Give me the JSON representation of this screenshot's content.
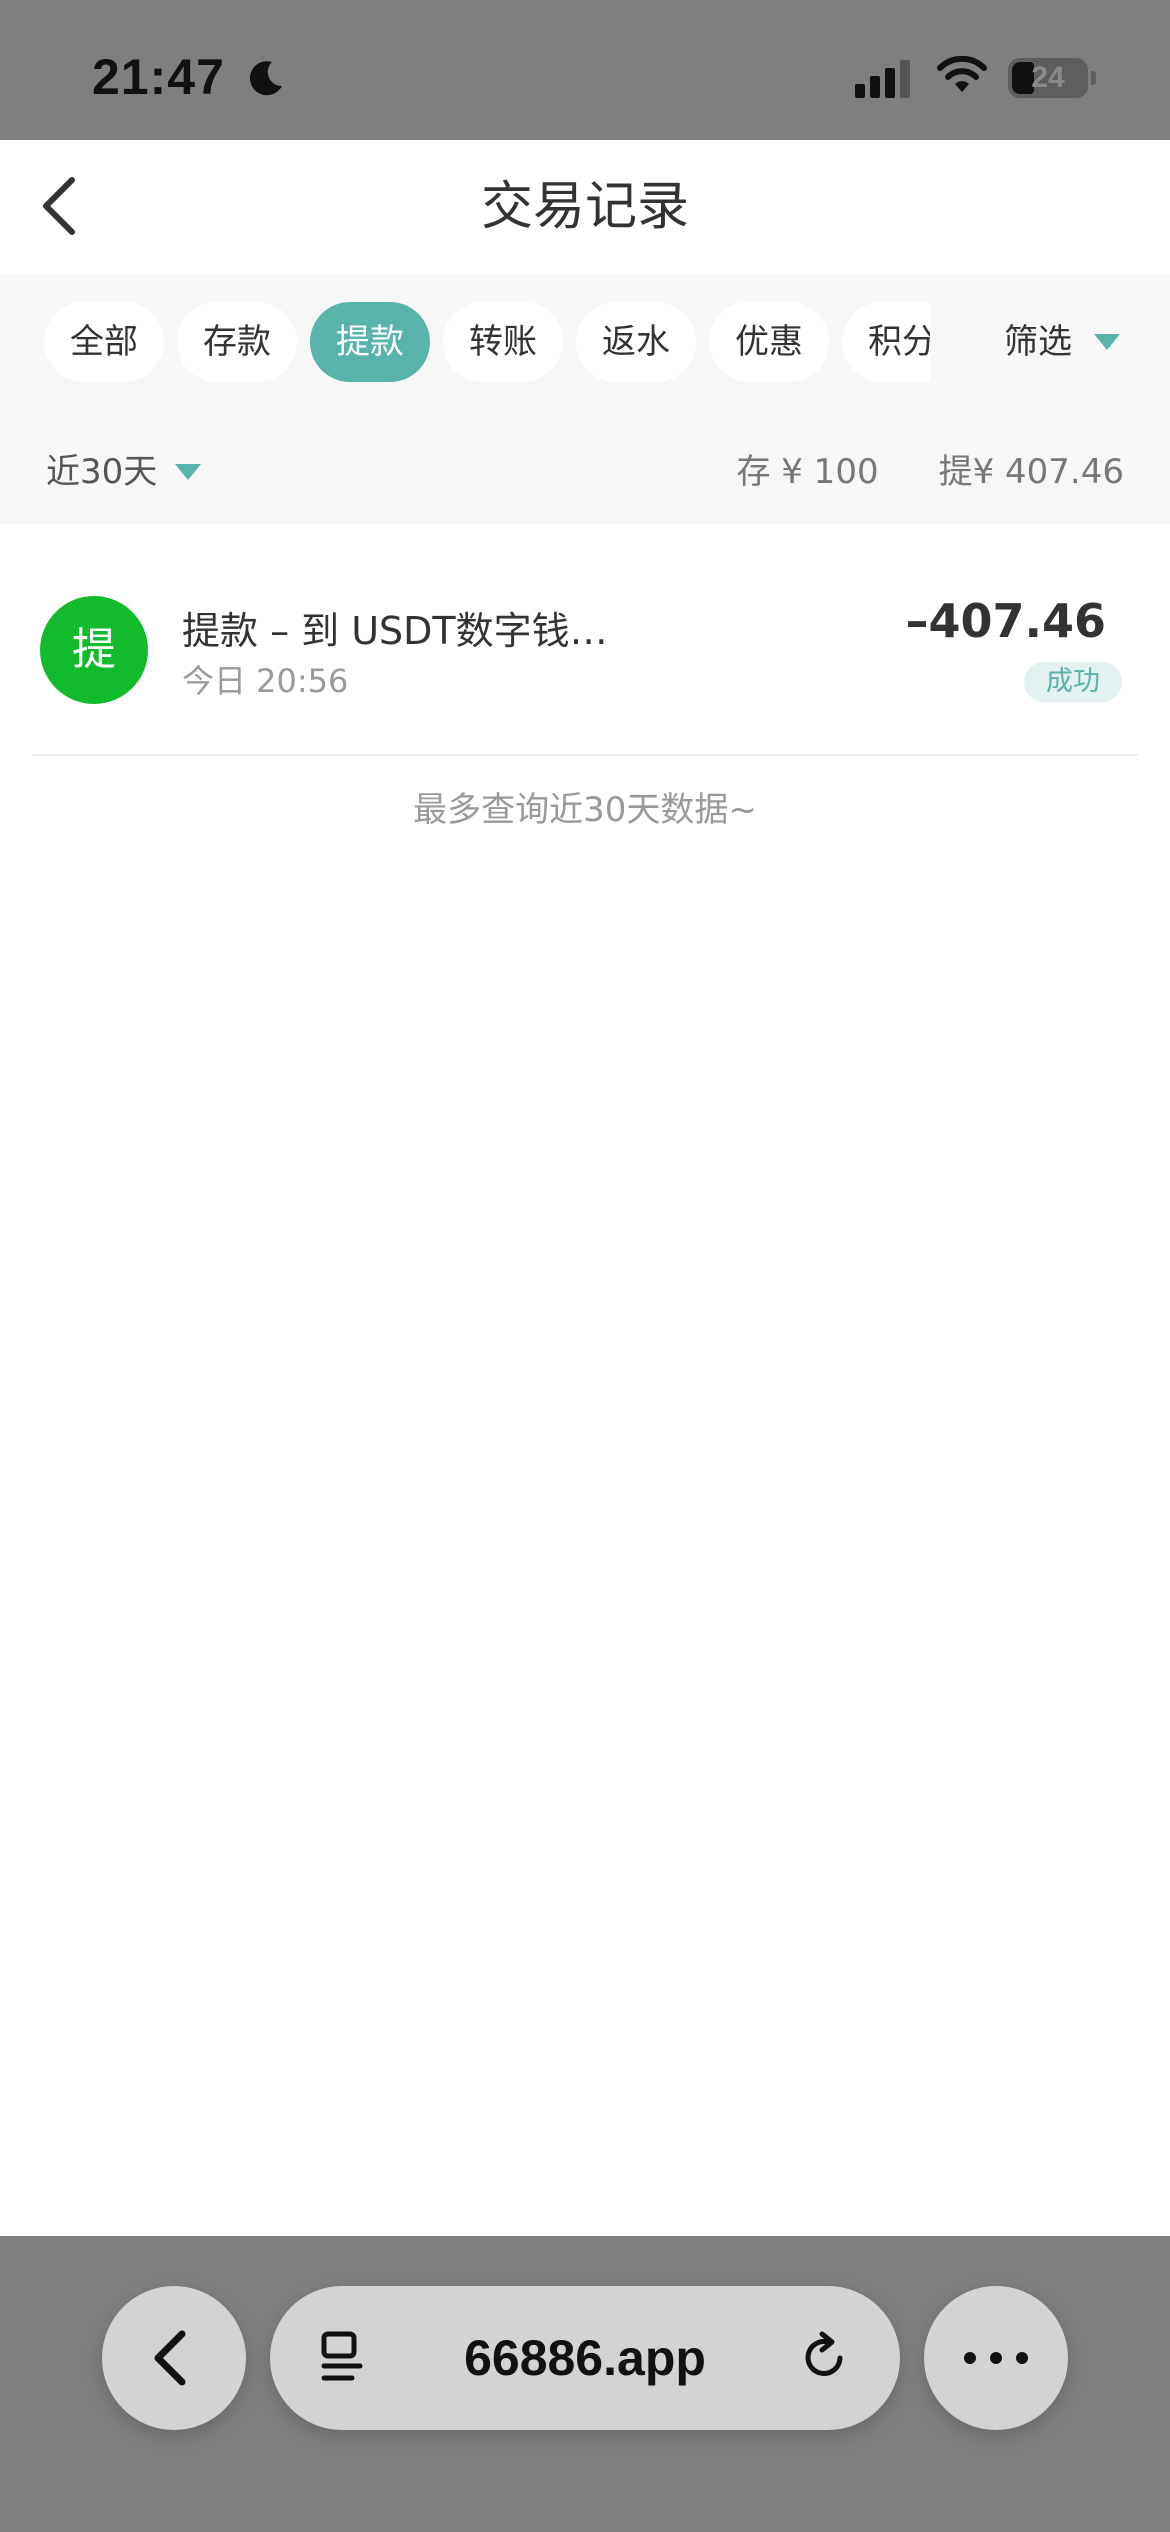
{
  "status_bar": {
    "time": "21:47",
    "battery": "24"
  },
  "header": {
    "title": "交易记录"
  },
  "filters": {
    "tabs": [
      {
        "label": "全部",
        "active": false
      },
      {
        "label": "存款",
        "active": false
      },
      {
        "label": "提款",
        "active": true
      },
      {
        "label": "转账",
        "active": false
      },
      {
        "label": "返水",
        "active": false
      },
      {
        "label": "优惠",
        "active": false
      },
      {
        "label": "积分",
        "active": false
      }
    ],
    "screen_label": "筛选",
    "range_label": "近30天",
    "deposit_total": "存 ¥ 100",
    "withdraw_total": "提¥ 407.46"
  },
  "transactions": [
    {
      "icon_char": "提",
      "title": "提款 – 到 USDT数字钱…",
      "date": "今日 20:56",
      "amount": "–407.46",
      "status": "成功"
    }
  ],
  "footer_note": "最多查询近30天数据~",
  "browser": {
    "url": "66886.app"
  },
  "colors": {
    "accent": "#58b3ab",
    "avatar_green": "#11bb2b",
    "status_bar_bg": "#7f7f7f"
  }
}
